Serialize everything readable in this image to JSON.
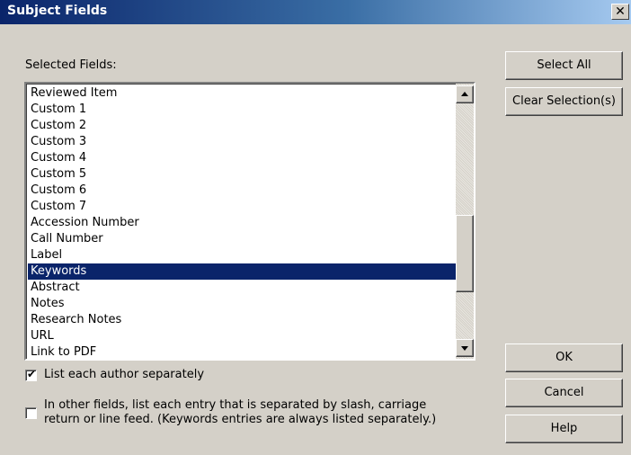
{
  "window": {
    "title": "Subject Fields",
    "close_glyph": "✕"
  },
  "selected_fields": {
    "label": "Selected Fields:",
    "items": [
      "Reviewed Item",
      "Custom 1",
      "Custom 2",
      "Custom 3",
      "Custom 4",
      "Custom 5",
      "Custom 6",
      "Custom 7",
      "Accession Number",
      "Call Number",
      "Label",
      "Keywords",
      "Abstract",
      "Notes",
      "Research Notes",
      "URL",
      "Link to PDF"
    ],
    "selected_item": "Keywords"
  },
  "options": {
    "list_authors_separately": {
      "label": "List each author separately",
      "checked": true
    },
    "list_entries_separately": {
      "label_line1": "In other fields, list each entry that is separated by slash, carriage",
      "label_line2": "return or line feed. (Keywords entries are always listed separately.)",
      "checked": false
    }
  },
  "buttons": {
    "select_all": "Select All",
    "clear_selection": "Clear Selection(s)",
    "ok": "OK",
    "cancel": "Cancel",
    "help": "Help"
  },
  "colors": {
    "selection": "#0a246a",
    "dialog_bg": "#d4d0c8",
    "title_start": "#0a246a",
    "title_end": "#a6caf0"
  }
}
